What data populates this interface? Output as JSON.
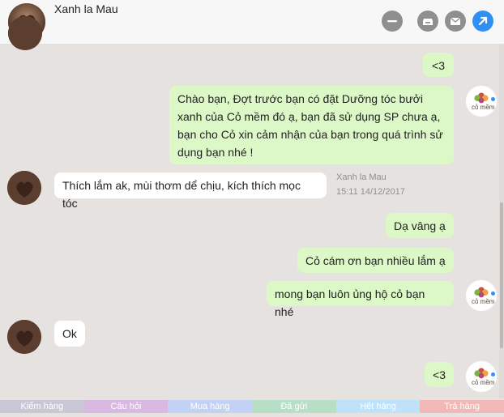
{
  "header": {
    "contact_name": "Xanh la Mau",
    "icons": [
      "minus-circle-icon",
      "archive-icon",
      "mail-icon",
      "share-arrow-icon"
    ],
    "colors": {
      "minus": "#8f8f8f",
      "archive": "#8f8f8f",
      "mail": "#8f8f8f",
      "share": "#2f8ff2"
    }
  },
  "messages": {
    "m1": "<3",
    "m2": "Chào bạn, Đợt trước bạn có đặt Dưỡng tóc bưởi xanh của Cỏ mềm đó ạ, bạn đã sử dụng SP chưa ạ, bạn cho Cỏ xin cảm nhận của bạn trong quá trình sử dụng bạn nhé !",
    "m3": "Thích lắm ak, mùi thơm dể chịu, kích thích mọc tóc",
    "m3_sender": "Xanh la Mau",
    "m3_time": "15:11 14/12/2017",
    "m4": "Dạ vâng ạ",
    "m5": "Cỏ cám ơn bạn nhiều lắm ạ",
    "m6": "mong bạn luôn ủng hộ cỏ bạn nhé",
    "m7": "Ok",
    "m8": "<3"
  },
  "brand": {
    "avatar_text": "cỏ mềm",
    "avatar_icon": "flower-logo-icon"
  },
  "tags": {
    "t1": "Kiểm hàng",
    "t2": "Câu hỏi",
    "t3": "Mua hàng",
    "t4": "Đã gửi",
    "t5": "Hết hàng",
    "t6": "Trả hàng",
    "colors": [
      "#c9c6d6",
      "#d9b9e2",
      "#c2d1f6",
      "#b7dfc5",
      "#bfe2fb",
      "#f2b7b7"
    ]
  }
}
